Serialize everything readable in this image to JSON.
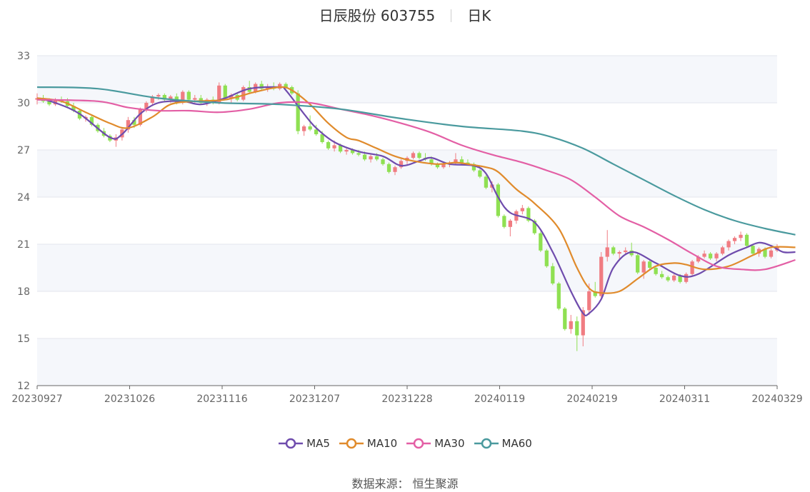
{
  "title": {
    "name": "日辰股份 603755",
    "period": "日K"
  },
  "source": {
    "label": "数据来源：",
    "value": "恒生聚源"
  },
  "chart_data": {
    "type": "candlestick",
    "ylim": [
      12,
      33
    ],
    "y_ticks": [
      12,
      15,
      18,
      21,
      24,
      27,
      30,
      33
    ],
    "grid": true,
    "legend_position": "bottom",
    "x_ticks": [
      "20230927",
      "20231026",
      "20231116",
      "20231207",
      "20231228",
      "20240119",
      "20240219",
      "20240311",
      "20240329"
    ],
    "up_color": "#f07c82",
    "down_color": "#8fe052",
    "ohlc": [
      [
        30.2,
        30.6,
        29.9,
        30.3
      ],
      [
        30.3,
        30.5,
        30.0,
        30.1
      ],
      [
        30.1,
        30.3,
        29.8,
        29.9
      ],
      [
        29.9,
        30.3,
        29.8,
        30.2
      ],
      [
        30.2,
        30.4,
        30.0,
        30.1
      ],
      [
        30.1,
        30.3,
        29.7,
        29.8
      ],
      [
        29.8,
        30.0,
        29.4,
        29.5
      ],
      [
        29.5,
        29.6,
        28.9,
        29.0
      ],
      [
        29.0,
        29.2,
        28.8,
        29.1
      ],
      [
        29.1,
        29.2,
        28.5,
        28.6
      ],
      [
        28.6,
        28.7,
        28.1,
        28.2
      ],
      [
        28.2,
        28.4,
        27.8,
        27.9
      ],
      [
        27.9,
        28.0,
        27.5,
        27.6
      ],
      [
        27.6,
        28.0,
        27.2,
        27.8
      ],
      [
        27.8,
        28.4,
        27.6,
        28.3
      ],
      [
        28.3,
        29.1,
        28.1,
        28.9
      ],
      [
        28.9,
        29.1,
        28.4,
        28.6
      ],
      [
        28.6,
        29.7,
        28.5,
        29.6
      ],
      [
        29.6,
        30.1,
        29.4,
        30.0
      ],
      [
        30.0,
        30.5,
        29.8,
        30.4
      ],
      [
        30.4,
        30.6,
        30.2,
        30.5
      ],
      [
        30.5,
        30.6,
        30.1,
        30.2
      ],
      [
        30.2,
        30.5,
        30.0,
        30.4
      ],
      [
        30.4,
        30.6,
        29.9,
        30.0
      ],
      [
        30.0,
        30.8,
        29.9,
        30.7
      ],
      [
        30.7,
        30.8,
        30.1,
        30.2
      ],
      [
        30.2,
        30.5,
        30.0,
        30.3
      ],
      [
        30.3,
        30.5,
        29.9,
        30.0
      ],
      [
        30.0,
        30.3,
        29.8,
        30.2
      ],
      [
        30.2,
        30.4,
        29.9,
        30.0
      ],
      [
        30.0,
        31.3,
        29.9,
        31.1
      ],
      [
        31.1,
        31.2,
        30.2,
        30.3
      ],
      [
        30.3,
        30.6,
        30.0,
        30.5
      ],
      [
        30.5,
        30.6,
        30.1,
        30.2
      ],
      [
        30.2,
        31.1,
        30.1,
        31.0
      ],
      [
        31.0,
        31.4,
        30.6,
        30.7
      ],
      [
        30.7,
        31.3,
        30.6,
        31.2
      ],
      [
        31.2,
        31.4,
        30.8,
        30.9
      ],
      [
        30.9,
        31.2,
        30.7,
        31.0
      ],
      [
        31.0,
        31.3,
        30.8,
        30.9
      ],
      [
        30.9,
        31.3,
        30.8,
        31.2
      ],
      [
        31.2,
        31.3,
        30.9,
        31.0
      ],
      [
        31.0,
        31.1,
        30.5,
        30.6
      ],
      [
        30.6,
        30.8,
        28.0,
        28.2
      ],
      [
        28.2,
        28.6,
        27.9,
        28.5
      ],
      [
        28.5,
        29.2,
        28.2,
        28.3
      ],
      [
        28.3,
        28.6,
        27.9,
        28.0
      ],
      [
        28.0,
        28.2,
        27.4,
        27.5
      ],
      [
        27.5,
        27.6,
        27.0,
        27.1
      ],
      [
        27.1,
        27.6,
        26.9,
        27.3
      ],
      [
        27.3,
        27.4,
        26.8,
        26.9
      ],
      [
        26.9,
        27.1,
        26.7,
        27.0
      ],
      [
        27.0,
        27.1,
        26.7,
        26.8
      ],
      [
        26.8,
        27.0,
        26.6,
        26.7
      ],
      [
        26.7,
        26.9,
        26.3,
        26.4
      ],
      [
        26.4,
        26.7,
        26.2,
        26.6
      ],
      [
        26.6,
        26.8,
        26.3,
        26.4
      ],
      [
        26.4,
        26.5,
        26.0,
        26.1
      ],
      [
        26.1,
        26.2,
        25.5,
        25.6
      ],
      [
        25.6,
        26.0,
        25.4,
        25.9
      ],
      [
        25.9,
        26.4,
        25.8,
        26.3
      ],
      [
        26.3,
        26.6,
        26.1,
        26.5
      ],
      [
        26.5,
        26.9,
        26.4,
        26.8
      ],
      [
        26.8,
        26.9,
        26.4,
        26.5
      ],
      [
        26.5,
        26.8,
        26.3,
        26.4
      ],
      [
        26.4,
        26.6,
        26.0,
        26.1
      ],
      [
        26.1,
        26.2,
        25.8,
        25.9
      ],
      [
        25.9,
        26.2,
        25.8,
        26.1
      ],
      [
        26.1,
        26.3,
        25.9,
        26.2
      ],
      [
        26.2,
        26.8,
        26.1,
        26.4
      ],
      [
        26.4,
        26.6,
        26.1,
        26.2
      ],
      [
        26.2,
        26.4,
        26.0,
        26.1
      ],
      [
        26.1,
        26.2,
        25.6,
        25.7
      ],
      [
        25.7,
        25.8,
        25.2,
        25.3
      ],
      [
        25.3,
        25.4,
        24.5,
        24.6
      ],
      [
        24.6,
        25.0,
        24.3,
        24.8
      ],
      [
        24.8,
        24.9,
        22.7,
        22.8
      ],
      [
        22.8,
        22.9,
        22.0,
        22.1
      ],
      [
        22.1,
        22.6,
        21.5,
        22.5
      ],
      [
        22.5,
        23.2,
        22.3,
        23.1
      ],
      [
        23.1,
        23.5,
        22.9,
        23.3
      ],
      [
        23.3,
        23.4,
        22.4,
        22.5
      ],
      [
        22.5,
        22.6,
        21.6,
        21.7
      ],
      [
        21.7,
        21.8,
        20.5,
        20.6
      ],
      [
        20.6,
        20.7,
        19.5,
        19.6
      ],
      [
        19.6,
        19.8,
        18.4,
        18.5
      ],
      [
        18.5,
        18.6,
        16.8,
        16.9
      ],
      [
        16.9,
        17.0,
        15.5,
        15.6
      ],
      [
        15.6,
        16.5,
        15.3,
        16.1
      ],
      [
        16.1,
        16.4,
        14.2,
        15.2
      ],
      [
        15.2,
        17.0,
        14.5,
        16.8
      ],
      [
        16.8,
        18.5,
        16.5,
        18.0
      ],
      [
        18.0,
        18.6,
        17.6,
        17.7
      ],
      [
        17.7,
        20.5,
        17.6,
        20.2
      ],
      [
        20.2,
        21.9,
        19.9,
        20.8
      ],
      [
        20.8,
        20.9,
        20.3,
        20.4
      ],
      [
        20.4,
        20.6,
        20.0,
        20.5
      ],
      [
        20.5,
        20.8,
        20.3,
        20.6
      ],
      [
        20.6,
        21.1,
        20.2,
        20.3
      ],
      [
        20.3,
        20.4,
        19.1,
        19.2
      ],
      [
        19.2,
        20.0,
        18.8,
        19.9
      ],
      [
        19.9,
        20.0,
        19.4,
        19.5
      ],
      [
        19.5,
        19.6,
        19.0,
        19.1
      ],
      [
        19.1,
        19.3,
        18.8,
        18.9
      ],
      [
        18.9,
        19.0,
        18.6,
        18.7
      ],
      [
        18.7,
        19.1,
        18.6,
        19.0
      ],
      [
        19.0,
        19.1,
        18.5,
        18.6
      ],
      [
        18.6,
        19.2,
        18.5,
        19.1
      ],
      [
        19.1,
        20.0,
        19.0,
        19.9
      ],
      [
        19.9,
        20.3,
        19.8,
        20.2
      ],
      [
        20.2,
        20.6,
        20.1,
        20.4
      ],
      [
        20.4,
        20.5,
        20.0,
        20.1
      ],
      [
        20.1,
        20.5,
        19.9,
        20.4
      ],
      [
        20.4,
        20.9,
        20.3,
        20.8
      ],
      [
        20.8,
        21.3,
        20.6,
        21.2
      ],
      [
        21.2,
        21.5,
        21.0,
        21.4
      ],
      [
        21.4,
        21.8,
        21.2,
        21.6
      ],
      [
        21.6,
        21.7,
        20.8,
        20.9
      ],
      [
        20.9,
        21.0,
        20.3,
        20.4
      ],
      [
        20.4,
        20.8,
        20.2,
        20.7
      ],
      [
        20.7,
        20.8,
        20.1,
        20.2
      ],
      [
        20.2,
        20.7,
        20.1,
        20.6
      ],
      [
        20.6,
        21.0,
        20.5,
        20.8
      ]
    ],
    "series": [
      {
        "name": "MA5",
        "color": "#6f4cad",
        "points": [
          [
            0,
            30.3
          ],
          [
            3,
            30.0
          ],
          [
            7,
            29.3
          ],
          [
            12,
            27.8
          ],
          [
            14,
            28.0
          ],
          [
            17,
            29.3
          ],
          [
            20,
            30.0
          ],
          [
            24,
            30.1
          ],
          [
            27,
            29.9
          ],
          [
            31,
            30.3
          ],
          [
            35,
            30.9
          ],
          [
            40,
            31.0
          ],
          [
            41,
            30.8
          ],
          [
            44,
            29.3
          ],
          [
            46,
            28.4
          ],
          [
            49,
            27.5
          ],
          [
            53,
            26.9
          ],
          [
            57,
            26.6
          ],
          [
            60,
            26.0
          ],
          [
            63,
            26.3
          ],
          [
            65,
            26.5
          ],
          [
            68,
            26.1
          ],
          [
            72,
            26.0
          ],
          [
            74,
            25.5
          ],
          [
            76,
            24.0
          ],
          [
            78,
            23.0
          ],
          [
            82,
            22.4
          ],
          [
            85,
            20.5
          ],
          [
            88,
            18.0
          ],
          [
            90,
            16.6
          ],
          [
            91,
            16.6
          ],
          [
            93,
            17.5
          ],
          [
            95,
            19.5
          ],
          [
            98,
            20.5
          ],
          [
            102,
            19.8
          ],
          [
            106,
            19.0
          ],
          [
            109,
            19.1
          ],
          [
            114,
            20.3
          ],
          [
            117,
            20.8
          ],
          [
            119,
            21.1
          ],
          [
            121,
            20.9
          ],
          [
            123,
            20.5
          ],
          [
            125,
            20.5
          ]
        ]
      },
      {
        "name": "MA10",
        "color": "#e08b2c",
        "points": [
          [
            0,
            30.3
          ],
          [
            4,
            30.1
          ],
          [
            8,
            29.4
          ],
          [
            12,
            28.7
          ],
          [
            15,
            28.4
          ],
          [
            19,
            29.1
          ],
          [
            22,
            29.9
          ],
          [
            26,
            30.1
          ],
          [
            31,
            30.2
          ],
          [
            36,
            30.7
          ],
          [
            40,
            31.0
          ],
          [
            42,
            30.8
          ],
          [
            45,
            29.9
          ],
          [
            48,
            28.7
          ],
          [
            51,
            27.8
          ],
          [
            53,
            27.6
          ],
          [
            56,
            27.1
          ],
          [
            59,
            26.6
          ],
          [
            62,
            26.3
          ],
          [
            66,
            26.1
          ],
          [
            69,
            26.2
          ],
          [
            71,
            26.1
          ],
          [
            74,
            25.9
          ],
          [
            76,
            25.6
          ],
          [
            79,
            24.5
          ],
          [
            82,
            23.6
          ],
          [
            86,
            22.0
          ],
          [
            89,
            19.5
          ],
          [
            91,
            18.2
          ],
          [
            93,
            17.9
          ],
          [
            96,
            18.0
          ],
          [
            99,
            18.8
          ],
          [
            102,
            19.6
          ],
          [
            105,
            19.8
          ],
          [
            107,
            19.7
          ],
          [
            110,
            19.4
          ],
          [
            114,
            19.6
          ],
          [
            118,
            20.3
          ],
          [
            121,
            20.8
          ],
          [
            125,
            20.8
          ]
        ]
      },
      {
        "name": "MA30",
        "color": "#e35fa5",
        "points": [
          [
            0,
            30.2
          ],
          [
            10,
            30.1
          ],
          [
            15,
            29.7
          ],
          [
            20,
            29.5
          ],
          [
            25,
            29.5
          ],
          [
            30,
            29.4
          ],
          [
            35,
            29.6
          ],
          [
            40,
            30.0
          ],
          [
            45,
            30.0
          ],
          [
            50,
            29.6
          ],
          [
            55,
            29.2
          ],
          [
            60,
            28.7
          ],
          [
            65,
            28.1
          ],
          [
            70,
            27.3
          ],
          [
            75,
            26.7
          ],
          [
            80,
            26.2
          ],
          [
            84,
            25.7
          ],
          [
            88,
            25.1
          ],
          [
            92,
            24.0
          ],
          [
            96,
            22.8
          ],
          [
            100,
            22.1
          ],
          [
            104,
            21.3
          ],
          [
            108,
            20.4
          ],
          [
            112,
            19.6
          ],
          [
            116,
            19.4
          ],
          [
            120,
            19.4
          ],
          [
            125,
            20.0
          ]
        ]
      },
      {
        "name": "MA60",
        "color": "#4a9a9e",
        "points": [
          [
            0,
            31.0
          ],
          [
            10,
            30.9
          ],
          [
            20,
            30.3
          ],
          [
            30,
            30.0
          ],
          [
            40,
            29.9
          ],
          [
            50,
            29.6
          ],
          [
            60,
            29.0
          ],
          [
            70,
            28.5
          ],
          [
            80,
            28.2
          ],
          [
            85,
            27.8
          ],
          [
            90,
            27.1
          ],
          [
            95,
            26.1
          ],
          [
            100,
            25.1
          ],
          [
            105,
            24.1
          ],
          [
            110,
            23.2
          ],
          [
            115,
            22.5
          ],
          [
            120,
            22.0
          ],
          [
            125,
            21.6
          ]
        ]
      }
    ]
  }
}
